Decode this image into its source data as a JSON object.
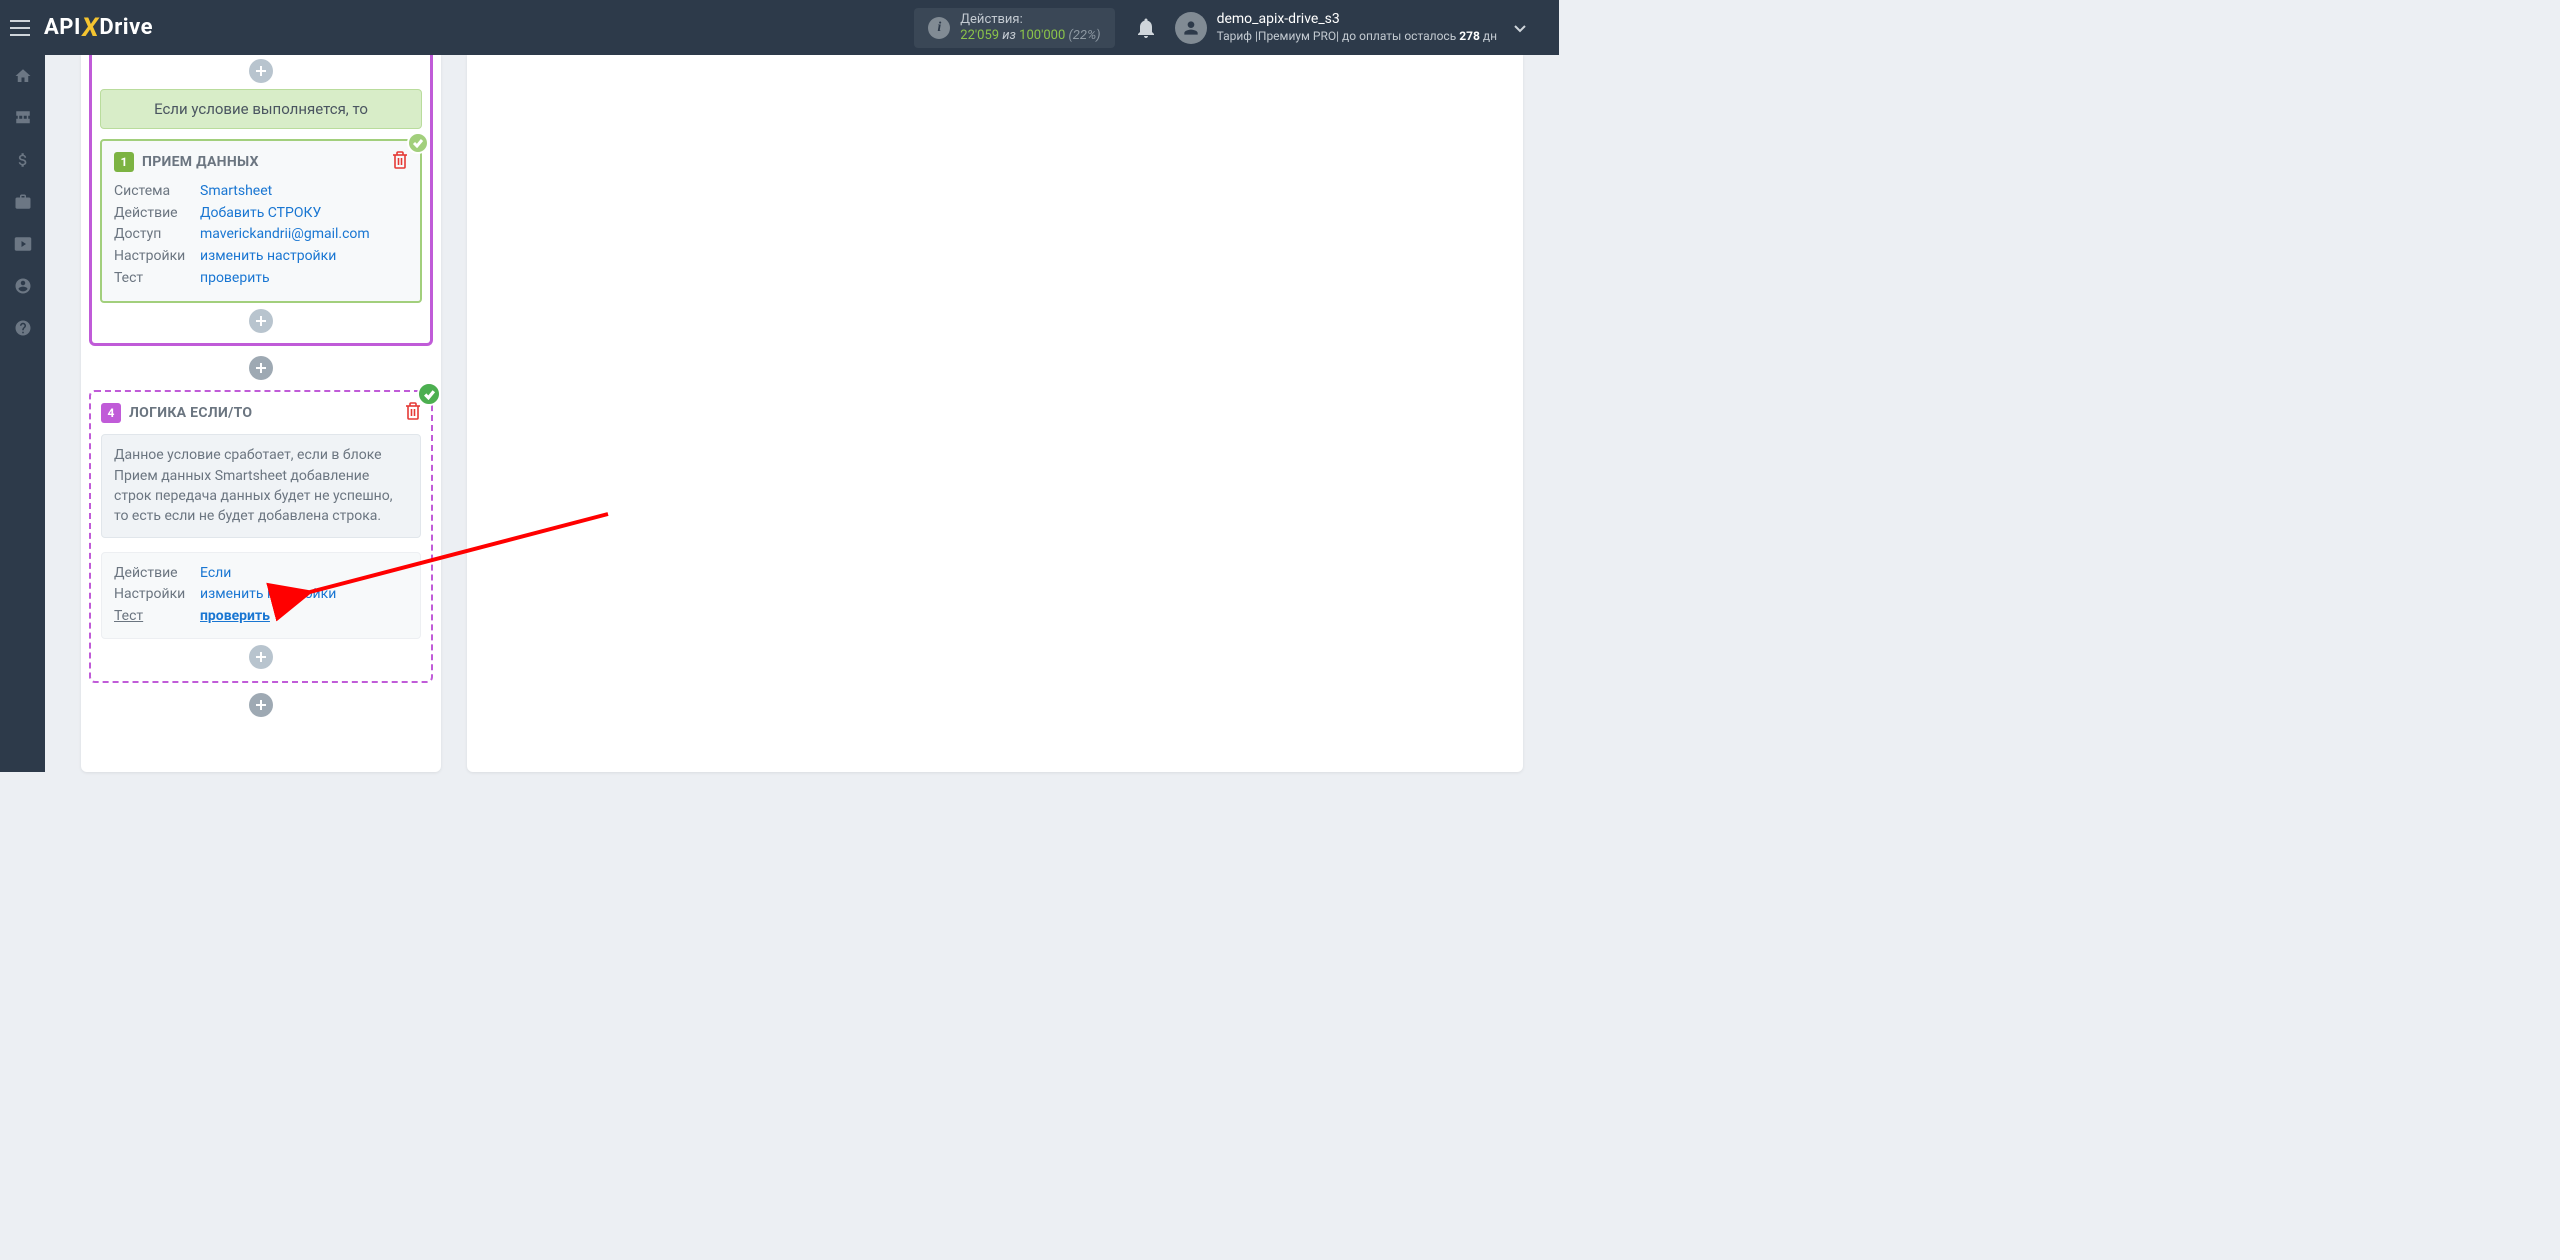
{
  "header": {
    "actions_label": "Действия:",
    "actions_used": "22'059",
    "actions_of": " из ",
    "actions_total": "100'000",
    "actions_pct": " (22%)",
    "user_name": "demo_apix-drive_s3",
    "tariff_prefix": "Тариф |Премиум PRO| до оплаты осталось ",
    "days_left": "278",
    "days_suffix": " дн"
  },
  "block1": {
    "condition_banner": "Если условие выполняется, то",
    "step_num": "1",
    "step_title": "ПРИЕМ ДАННЫХ",
    "rows": {
      "system_l": "Система",
      "system_v": "Smartsheet",
      "action_l": "Действие",
      "action_v": "Добавить СТРОКУ",
      "access_l": "Доступ",
      "access_v": "maverickandrii@gmail.com",
      "settings_l": "Настройки",
      "settings_v": "изменить настройки",
      "test_l": "Тест",
      "test_v": "проверить"
    }
  },
  "block4": {
    "step_num": "4",
    "step_title": "ЛОГИКА ЕСЛИ/ТО",
    "note": "Данное условие сработает, если в блоке Прием данных Smartsheet добавление строк передача данных будет не успешно, то есть если не будет добавлена строка.",
    "rows": {
      "action_l": "Действие",
      "action_v": "Если",
      "settings_l": "Настройки",
      "settings_v": "изменить настройки",
      "test_l": "Тест",
      "test_v": "проверить"
    }
  }
}
